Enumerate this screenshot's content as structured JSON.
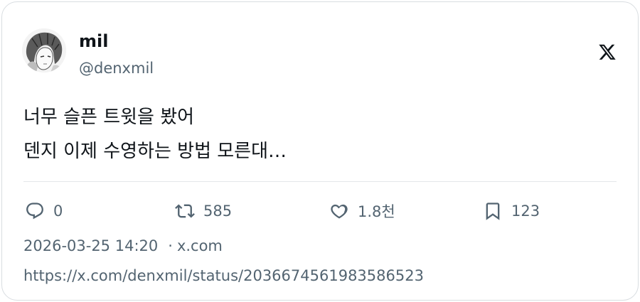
{
  "tweet": {
    "author_name": "mil",
    "author_handle": "@denxmil",
    "text_line1": "너무 슬픈 트윗을 봤어",
    "text_line2": "덴지 이제 수영하는 방법 모른대…",
    "timestamp": "2026-03-25 14:20",
    "separator": "·",
    "source": "x.com",
    "url": "https://x.com/denxmil/status/2036674561983586523"
  },
  "actions": {
    "replies": "0",
    "retweets": "585",
    "likes": "1.8천",
    "bookmarks": "123"
  },
  "icons": {
    "brand": "x-logo-icon",
    "reply": "reply-icon",
    "retweet": "retweet-icon",
    "like": "heart-icon",
    "bookmark": "bookmark-icon"
  },
  "colors": {
    "primary_text": "#0f1419",
    "secondary_text": "#536471",
    "border": "#d9dde1"
  }
}
